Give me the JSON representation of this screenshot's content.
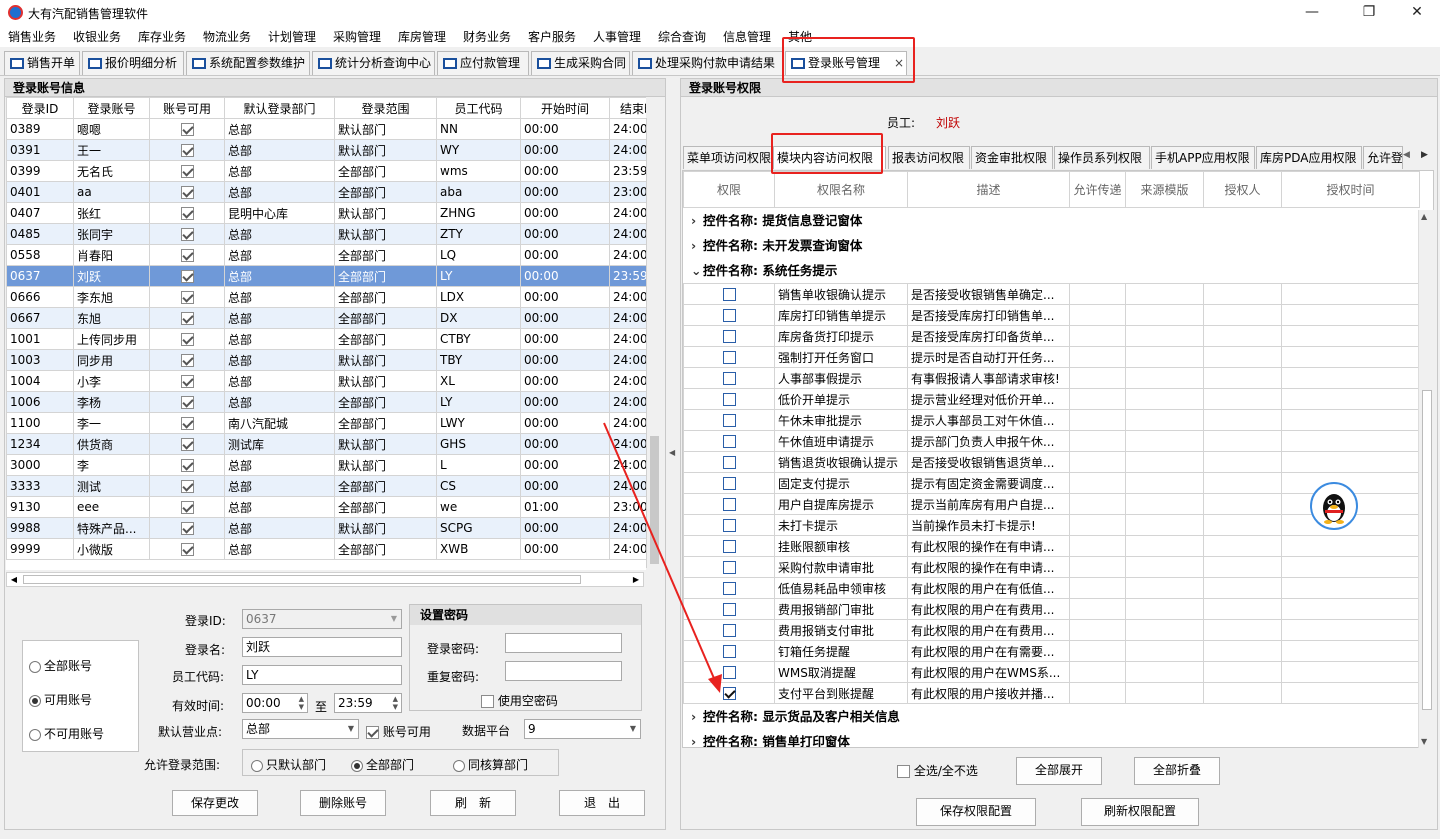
{
  "window": {
    "title": "大有汽配销售管理软件",
    "min": "—",
    "max": "❐",
    "close": "✕"
  },
  "menus": [
    "销售业务",
    "收银业务",
    "库存业务",
    "物流业务",
    "计划管理",
    "采购管理",
    "库房管理",
    "财务业务",
    "客户服务",
    "人事管理",
    "综合查询",
    "信息管理",
    "其他"
  ],
  "tabs": [
    "销售开单",
    "报价明细分析",
    "系统配置参数维护",
    "统计分析查询中心",
    "应付款管理",
    "生成采购合同",
    "处理采购付款申请结果",
    "登录账号管理"
  ],
  "tab_close": "×",
  "left": {
    "title": "登录账号信息",
    "columns": [
      "登录ID",
      "登录账号",
      "账号可用",
      "默认登录部门",
      "登录范围",
      "员工代码",
      "开始时间",
      "结束时"
    ],
    "rows": [
      [
        "0389",
        "嗯嗯",
        "1",
        "总部",
        "默认部门",
        "NN",
        "00:00",
        "24:00"
      ],
      [
        "0391",
        "王一",
        "1",
        "总部",
        "默认部门",
        "WY",
        "00:00",
        "24:00"
      ],
      [
        "0399",
        "无名氏",
        "1",
        "总部",
        "全部部门",
        "wms",
        "00:00",
        "23:59"
      ],
      [
        "0401",
        "aa",
        "1",
        "总部",
        "全部部门",
        "aba",
        "00:00",
        "23:00"
      ],
      [
        "0407",
        "张红",
        "1",
        "昆明中心库",
        "默认部门",
        "ZHNG",
        "00:00",
        "24:00"
      ],
      [
        "0485",
        "张同宇",
        "1",
        "总部",
        "默认部门",
        "ZTY",
        "00:00",
        "24:00"
      ],
      [
        "0558",
        "肖春阳",
        "1",
        "总部",
        "全部部门",
        "LQ",
        "00:00",
        "24:00"
      ],
      [
        "0637",
        "刘跃",
        "1",
        "总部",
        "全部部门",
        "LY",
        "00:00",
        "23:59"
      ],
      [
        "0666",
        "李东旭",
        "1",
        "总部",
        "全部部门",
        "LDX",
        "00:00",
        "24:00"
      ],
      [
        "0667",
        "东旭",
        "1",
        "总部",
        "全部部门",
        "DX",
        "00:00",
        "24:00"
      ],
      [
        "1001",
        "上传同步用",
        "1",
        "总部",
        "全部部门",
        "CTBY",
        "00:00",
        "24:00"
      ],
      [
        "1003",
        "同步用",
        "1",
        "总部",
        "默认部门",
        "TBY",
        "00:00",
        "24:00"
      ],
      [
        "1004",
        "小李",
        "1",
        "总部",
        "默认部门",
        "XL",
        "00:00",
        "24:00"
      ],
      [
        "1006",
        "李杨",
        "1",
        "总部",
        "全部部门",
        "LY",
        "00:00",
        "24:00"
      ],
      [
        "1100",
        "李一",
        "1",
        "南八汽配城",
        "全部部门",
        "LWY",
        "00:00",
        "24:00"
      ],
      [
        "1234",
        "供货商",
        "1",
        "测试库",
        "默认部门",
        "GHS",
        "00:00",
        "24:00"
      ],
      [
        "3000",
        "李",
        "1",
        "总部",
        "默认部门",
        "L",
        "00:00",
        "24:00"
      ],
      [
        "3333",
        "测试",
        "1",
        "总部",
        "全部部门",
        "CS",
        "00:00",
        "24:00"
      ],
      [
        "9130",
        "eee",
        "1",
        "总部",
        "全部部门",
        "we",
        "01:00",
        "23:00"
      ],
      [
        "9988",
        "特殊产品...",
        "1",
        "总部",
        "默认部门",
        "SCPG",
        "00:00",
        "24:00"
      ],
      [
        "9999",
        "小微版",
        "1",
        "总部",
        "全部部门",
        "XWB",
        "00:00",
        "24:00"
      ]
    ],
    "filter": {
      "options": [
        "全部账号",
        "可用账号",
        "不可用账号"
      ],
      "selected": 1
    },
    "form": {
      "id_label": "登录ID:",
      "id_value": "0637",
      "name_label": "登录名:",
      "name_value": "刘跃",
      "code_label": "员工代码:",
      "code_value": "LY",
      "time_label": "有效时间:",
      "time_from": "00:00",
      "time_to_label": "至",
      "time_to": "23:59",
      "branch_label": "默认营业点:",
      "branch_value": "总部",
      "enabled_label": "账号可用",
      "platform_label": "数据平台",
      "platform_value": "9",
      "scope_label": "允许登录范围:",
      "scope_options": [
        "只默认部门",
        "全部部门",
        "同核算部门"
      ],
      "scope_selected": 1
    },
    "password": {
      "title": "设置密码",
      "pwd_label": "登录密码:",
      "repeat_label": "重复密码:",
      "empty_label": "使用空密码"
    },
    "buttons": [
      "保存更改",
      "删除账号",
      "刷　新",
      "退　出"
    ]
  },
  "right": {
    "title": "登录账号权限",
    "employee_label": "员工:",
    "employee_value": "刘跃",
    "subtabs": [
      "菜单项访问权限",
      "模块内容访问权限",
      "报表访问权限",
      "资金审批权限",
      "操作员系列权限",
      "手机APP应用权限",
      "库房PDA应用权限",
      "允许登"
    ],
    "columns": [
      "权限",
      "权限名称",
      "描述",
      "允许传递",
      "来源模版",
      "授权人",
      "授权时间"
    ],
    "groups_top": [
      "控件名称: 提货信息登记窗体",
      "控件名称: 未开发票查询窗体",
      "控件名称: 系统任务提示"
    ],
    "perm_rows": [
      [
        "0",
        "销售单收银确认提示",
        "是否接受收银销售单确定..."
      ],
      [
        "0",
        "库房打印销售单提示",
        "是否接受库房打印销售单..."
      ],
      [
        "0",
        "库房备货打印提示",
        "是否接受库房打印备货单..."
      ],
      [
        "0",
        "强制打开任务窗口",
        "提示时是否自动打开任务..."
      ],
      [
        "0",
        "人事部事假提示",
        "有事假报请人事部请求审核!"
      ],
      [
        "0",
        "低价开单提示",
        "提示营业经理对低价开单..."
      ],
      [
        "0",
        "午休未审批提示",
        "提示人事部员工对午休值..."
      ],
      [
        "0",
        "午休值班申请提示",
        "提示部门负责人申报午休..."
      ],
      [
        "0",
        "销售退货收银确认提示",
        "是否接受收银销售退货单..."
      ],
      [
        "0",
        "固定支付提示",
        "提示有固定资金需要调度..."
      ],
      [
        "0",
        "用户自提库房提示",
        "提示当前库房有用户自提..."
      ],
      [
        "0",
        "未打卡提示",
        "当前操作员未打卡提示!"
      ],
      [
        "0",
        "挂账限额审核",
        "有此权限的操作在有申请..."
      ],
      [
        "0",
        "采购付款申请审批",
        "有此权限的操作在有申请..."
      ],
      [
        "0",
        "低值易耗品申领审核",
        "有此权限的用户在有低值..."
      ],
      [
        "0",
        "费用报销部门审批",
        "有此权限的用户在有费用..."
      ],
      [
        "0",
        "费用报销支付审批",
        "有此权限的用户在有费用..."
      ],
      [
        "0",
        "钉箱任务提醒",
        "有此权限的用户在有需要..."
      ],
      [
        "0",
        "WMS取消提醒",
        "有此权限的用户在WMS系..."
      ],
      [
        "1",
        "支付平台到账提醒",
        "有此权限的用户接收并播..."
      ]
    ],
    "groups_bottom": [
      "控件名称: 显示货品及客户相关信息",
      "控件名称: 销售单打印窗体"
    ],
    "select_all": "全选/全不选",
    "expand_all": "全部展开",
    "collapse_all": "全部折叠",
    "save": "保存权限配置",
    "refresh": "刷新权限配置"
  }
}
